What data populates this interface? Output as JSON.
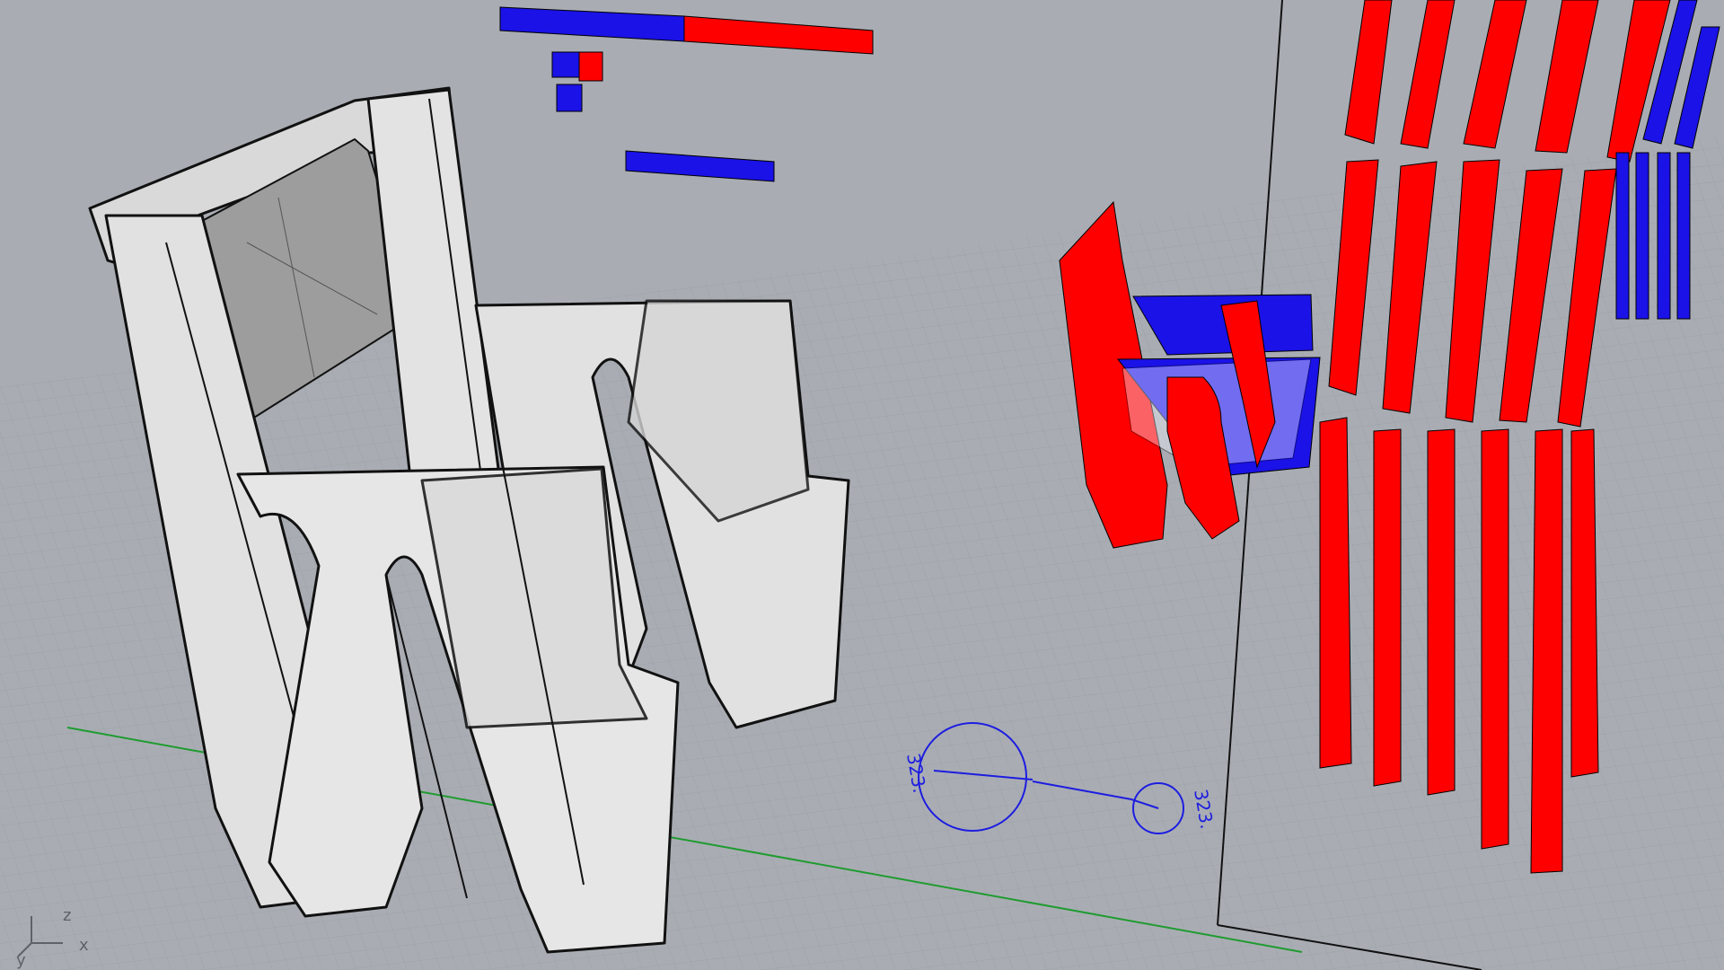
{
  "viewport": {
    "background": "#a9adb3",
    "grid_color": "#9aa0a7",
    "x_axis_color": "#1f9b2f",
    "selection_red": "#ff0000",
    "selection_blue": "#1a12e6",
    "wire_color": "#111111",
    "surface_color": "#e1e1e1"
  },
  "dimensions": [
    {
      "value": "323."
    },
    {
      "value": "323."
    }
  ],
  "axis_widget": {
    "z": "z",
    "y": "y",
    "x": "x"
  }
}
